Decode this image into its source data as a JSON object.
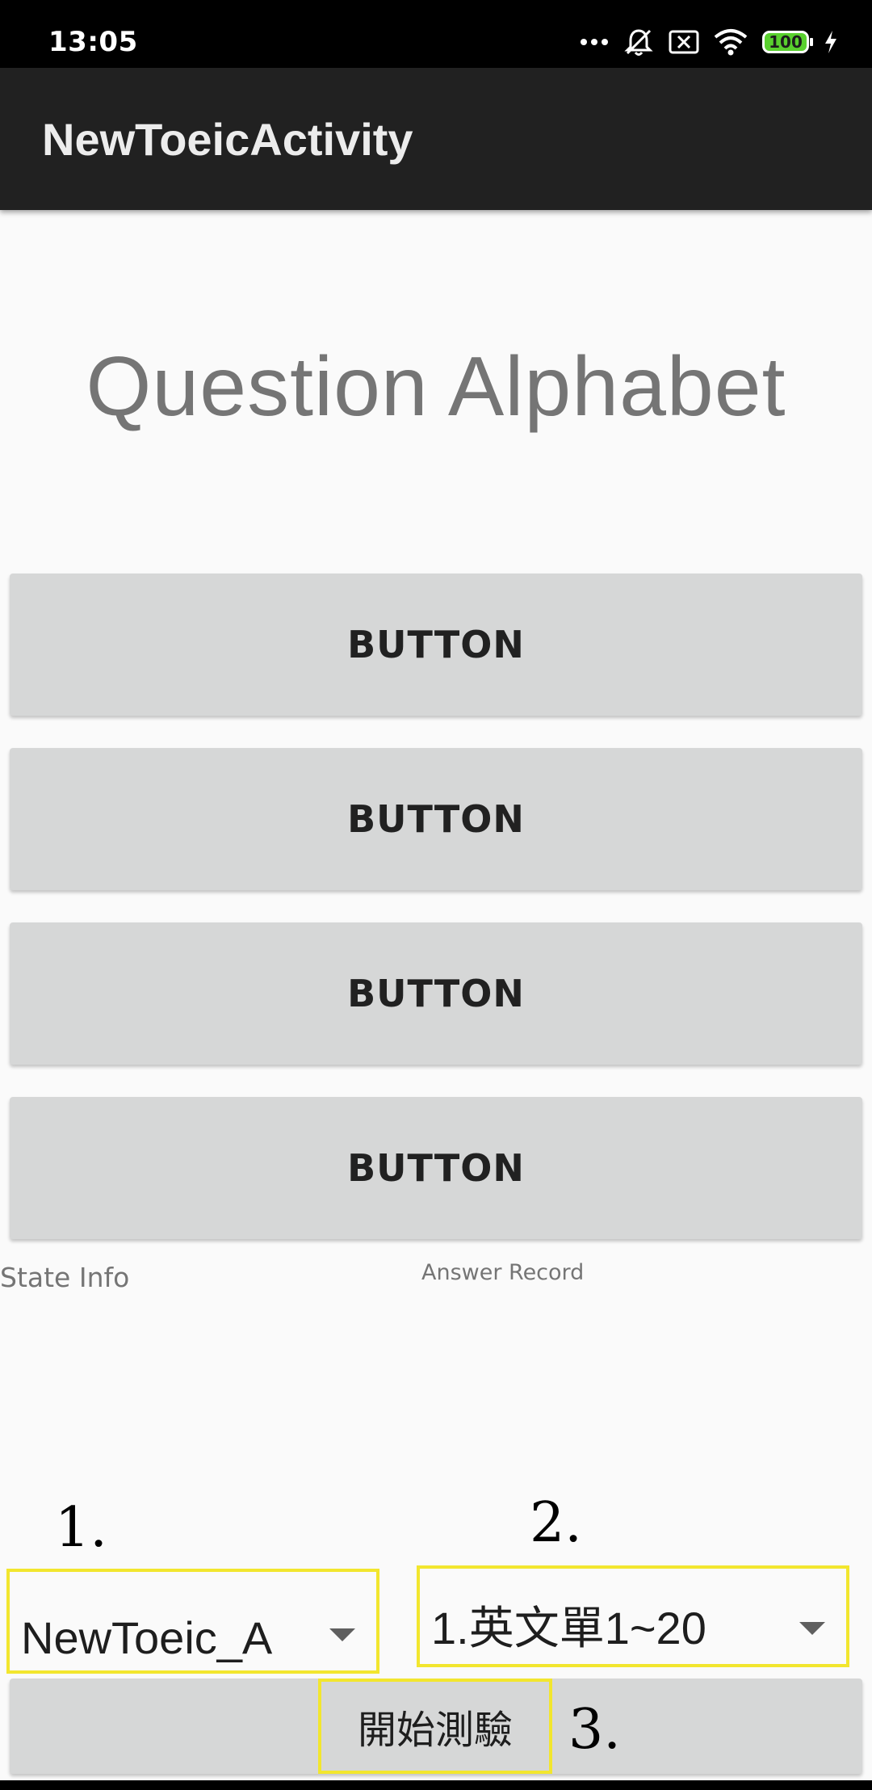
{
  "status_bar": {
    "time": "13:05",
    "battery_level": "100",
    "icons": [
      "more-dots-icon",
      "notifications-muted-icon",
      "sim-x-icon",
      "wifi-icon",
      "battery-icon",
      "charging-bolt-icon"
    ]
  },
  "app_bar": {
    "title": "NewToeicActivity"
  },
  "question": {
    "text": "Question Alphabet"
  },
  "answers": [
    {
      "label": "BUTTON"
    },
    {
      "label": "BUTTON"
    },
    {
      "label": "BUTTON"
    },
    {
      "label": "BUTTON"
    }
  ],
  "info": {
    "state": "State Info",
    "answer_record": "Answer Record"
  },
  "annotations": {
    "m1": "1.",
    "m2": "2.",
    "m3": "3."
  },
  "spinners": {
    "book": {
      "value": "NewToeic_A"
    },
    "range": {
      "value": "1.英文單1~20"
    }
  },
  "start_button": {
    "label": "開始測驗"
  },
  "colors": {
    "highlight": "#f2e62e",
    "app_bar": "#212121",
    "button": "#d6d7d7",
    "battery": "#59d02e"
  }
}
